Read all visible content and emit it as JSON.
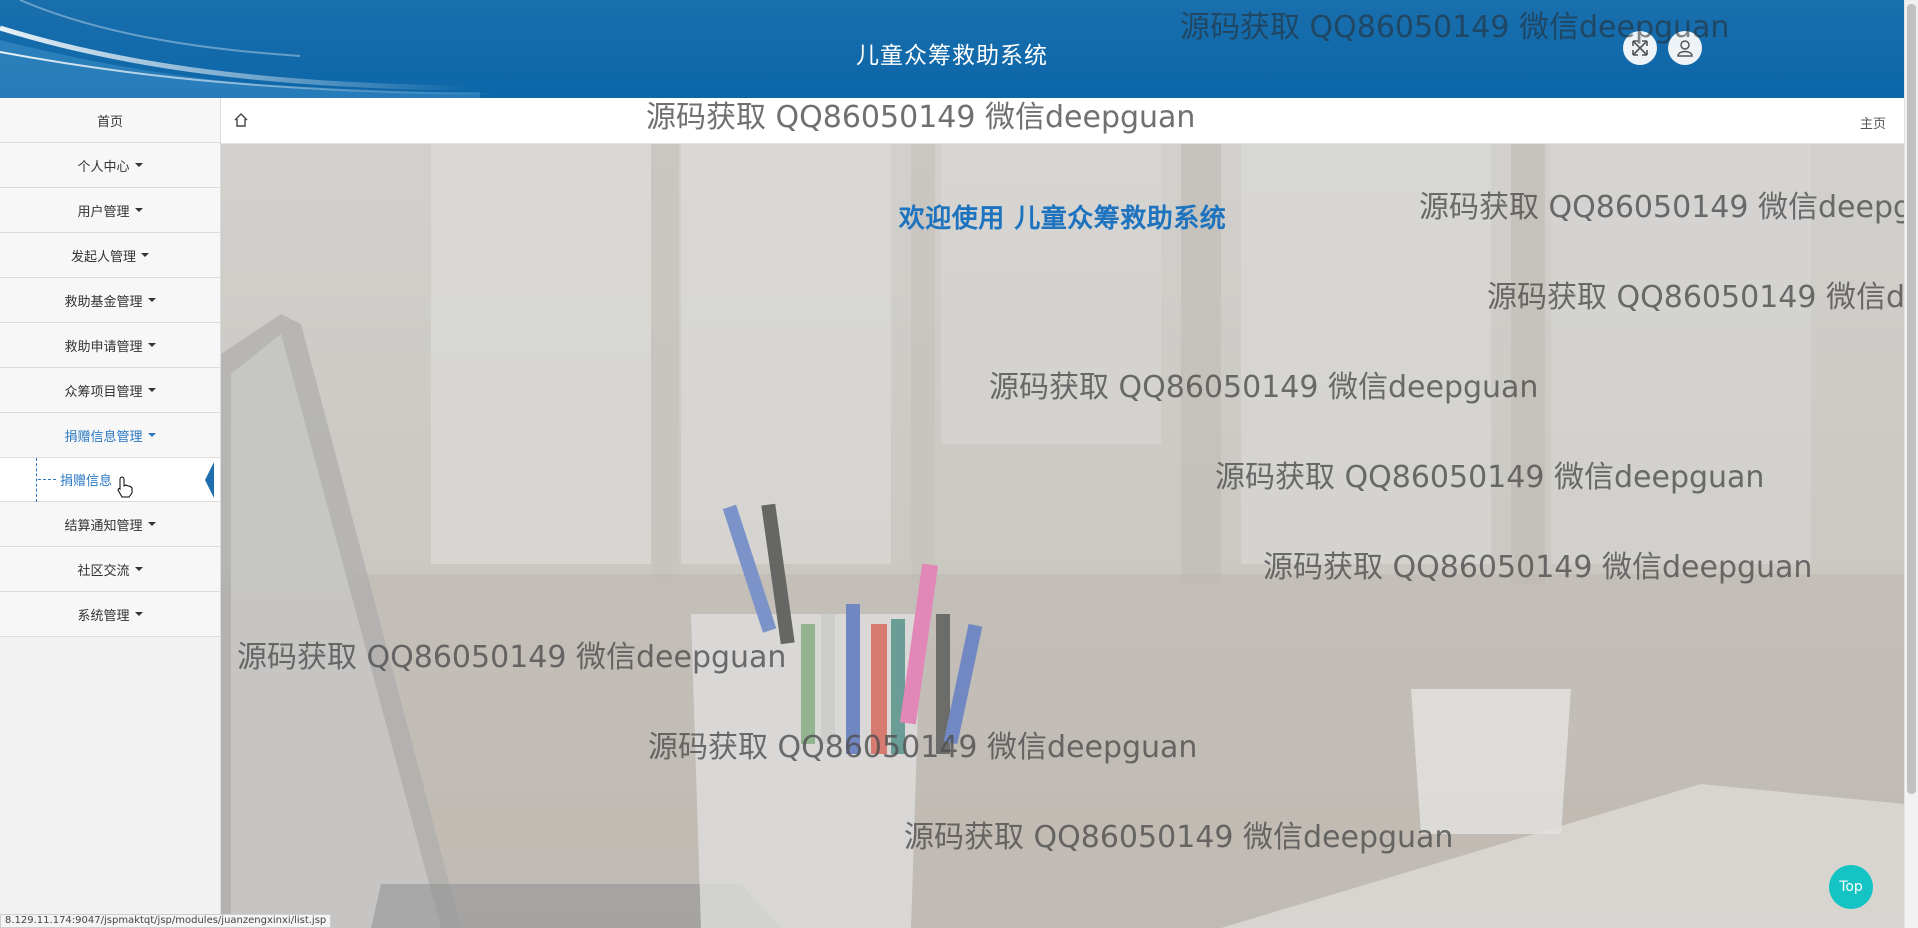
{
  "header": {
    "title": "儿童众筹救助系统",
    "fullscreen_icon": "expand-icon",
    "user_icon": "user-icon"
  },
  "sidebar": {
    "items": [
      {
        "label": "首页",
        "has_caret": false
      },
      {
        "label": "个人中心",
        "has_caret": true
      },
      {
        "label": "用户管理",
        "has_caret": true
      },
      {
        "label": "发起人管理",
        "has_caret": true
      },
      {
        "label": "救助基金管理",
        "has_caret": true
      },
      {
        "label": "救助申请管理",
        "has_caret": true
      },
      {
        "label": "众筹项目管理",
        "has_caret": true
      },
      {
        "label": "捐赠信息管理",
        "has_caret": true,
        "active": true
      },
      {
        "label": "结算通知管理",
        "has_caret": true
      },
      {
        "label": "社区交流",
        "has_caret": true
      },
      {
        "label": "系统管理",
        "has_caret": true
      }
    ],
    "sub_item": {
      "label": "捐赠信息"
    }
  },
  "breadcrumb": {
    "home_icon": "home-icon",
    "right_link": "主页"
  },
  "main": {
    "welcome": "欢迎使用 儿童众筹救助系统"
  },
  "watermark": "源码获取 QQ86050149 微信deepguan",
  "top_button": "Top",
  "status_url": "8.129.11.174:9047/jspmaktqt/jsp/modules/juanzengxinxi/list.jsp",
  "colors": {
    "header_bg": "#0c66a8",
    "accent": "#2a78c2",
    "top_button": "#14c3c3"
  }
}
